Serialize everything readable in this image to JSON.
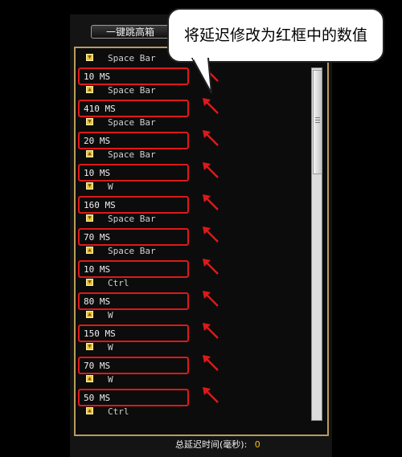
{
  "toolbar": {
    "one_key_label": "一键跳高箱"
  },
  "callout": {
    "text": "将延迟修改为红框中的数值"
  },
  "rows": [
    {
      "type": "key",
      "key": "Space Bar",
      "dir": "down"
    },
    {
      "type": "delay",
      "value": "10 MS"
    },
    {
      "type": "key",
      "key": "Space Bar",
      "dir": "up"
    },
    {
      "type": "delay",
      "value": "410 MS"
    },
    {
      "type": "key",
      "key": "Space Bar",
      "dir": "down"
    },
    {
      "type": "delay",
      "value": "20 MS"
    },
    {
      "type": "key",
      "key": "Space Bar",
      "dir": "up"
    },
    {
      "type": "delay",
      "value": "10 MS"
    },
    {
      "type": "key",
      "key": "W",
      "dir": "down"
    },
    {
      "type": "delay",
      "value": "160 MS"
    },
    {
      "type": "key",
      "key": "Space Bar",
      "dir": "down"
    },
    {
      "type": "delay",
      "value": "70 MS"
    },
    {
      "type": "key",
      "key": "Space Bar",
      "dir": "up"
    },
    {
      "type": "delay",
      "value": "10 MS"
    },
    {
      "type": "key",
      "key": "Ctrl",
      "dir": "down"
    },
    {
      "type": "delay",
      "value": "80 MS"
    },
    {
      "type": "key",
      "key": "W",
      "dir": "up"
    },
    {
      "type": "delay",
      "value": "150 MS"
    },
    {
      "type": "key",
      "key": "W",
      "dir": "down"
    },
    {
      "type": "delay",
      "value": "70 MS"
    },
    {
      "type": "key",
      "key": "W",
      "dir": "up"
    },
    {
      "type": "delay",
      "value": "50 MS"
    },
    {
      "type": "key",
      "key": "Ctrl",
      "dir": "up"
    }
  ],
  "footer": {
    "total_label": "总延迟时间(毫秒):",
    "total_value": "0"
  },
  "colors": {
    "highlight": "#e01818",
    "frame": "#b89c5c",
    "key_icon": "#e8c43a"
  }
}
